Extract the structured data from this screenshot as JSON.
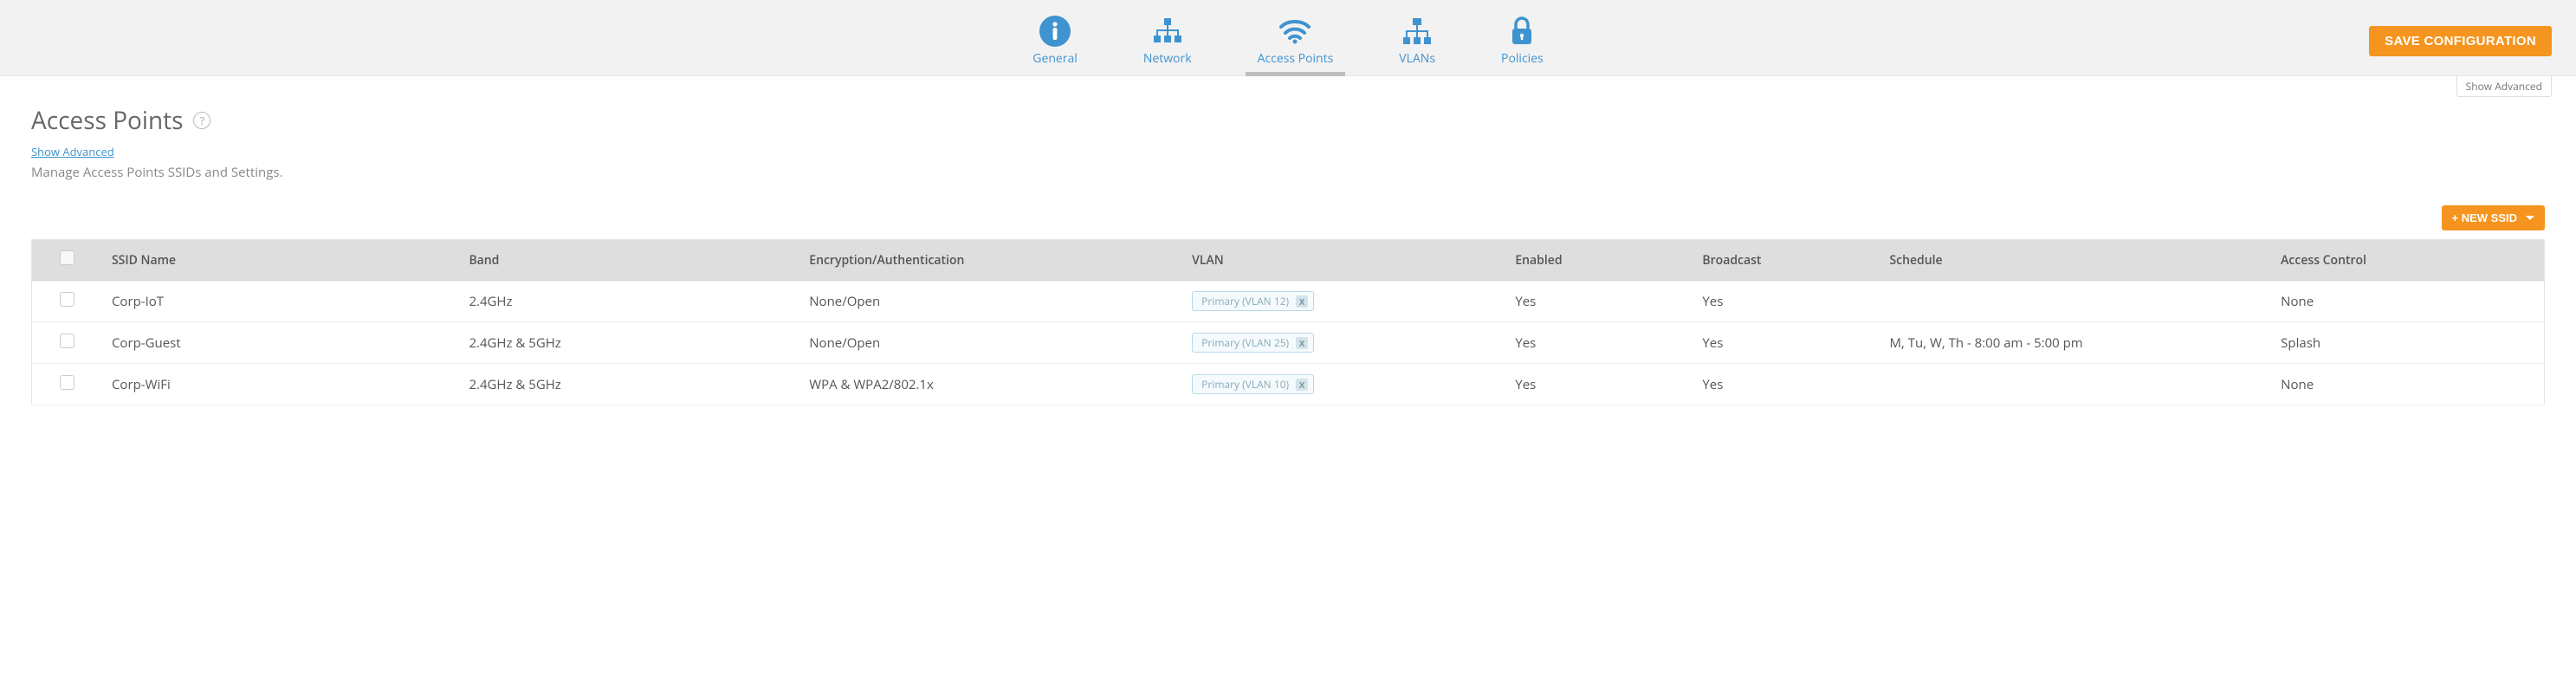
{
  "tabs": [
    {
      "id": "general",
      "label": "General",
      "active": false
    },
    {
      "id": "network",
      "label": "Network",
      "active": false
    },
    {
      "id": "access-points",
      "label": "Access Points",
      "active": true
    },
    {
      "id": "vlans",
      "label": "VLANs",
      "active": false
    },
    {
      "id": "policies",
      "label": "Policies",
      "active": false
    }
  ],
  "buttons": {
    "save_configuration": "SAVE CONFIGURATION",
    "show_advanced_top": "Show Advanced",
    "new_ssid": "+ NEW SSID"
  },
  "page": {
    "title": "Access Points",
    "help_glyph": "?",
    "show_advanced_link": "Show Advanced",
    "description": "Manage Access Points SSIDs and Settings."
  },
  "table": {
    "columns": {
      "ssid_name": "SSID Name",
      "band": "Band",
      "encryption": "Encryption/Authentication",
      "vlan": "VLAN",
      "enabled": "Enabled",
      "broadcast": "Broadcast",
      "schedule": "Schedule",
      "access_control": "Access Control"
    },
    "rows": [
      {
        "ssid_name": "Corp-IoT",
        "band": "2.4GHz",
        "encryption": "None/Open",
        "vlan_tag": "Primary (VLAN 12)",
        "enabled": "Yes",
        "broadcast": "Yes",
        "schedule": "",
        "access_control": "None"
      },
      {
        "ssid_name": "Corp-Guest",
        "band": "2.4GHz & 5GHz",
        "encryption": "None/Open",
        "vlan_tag": "Primary (VLAN 25)",
        "enabled": "Yes",
        "broadcast": "Yes",
        "schedule": "M, Tu, W, Th - 8:00 am - 5:00 pm",
        "access_control": "Splash"
      },
      {
        "ssid_name": "Corp-WiFi",
        "band": "2.4GHz & 5GHz",
        "encryption": "WPA & WPA2/802.1x",
        "vlan_tag": "Primary (VLAN 10)",
        "enabled": "Yes",
        "broadcast": "Yes",
        "schedule": "",
        "access_control": "None"
      }
    ],
    "vlan_tag_remove_glyph": "X"
  }
}
